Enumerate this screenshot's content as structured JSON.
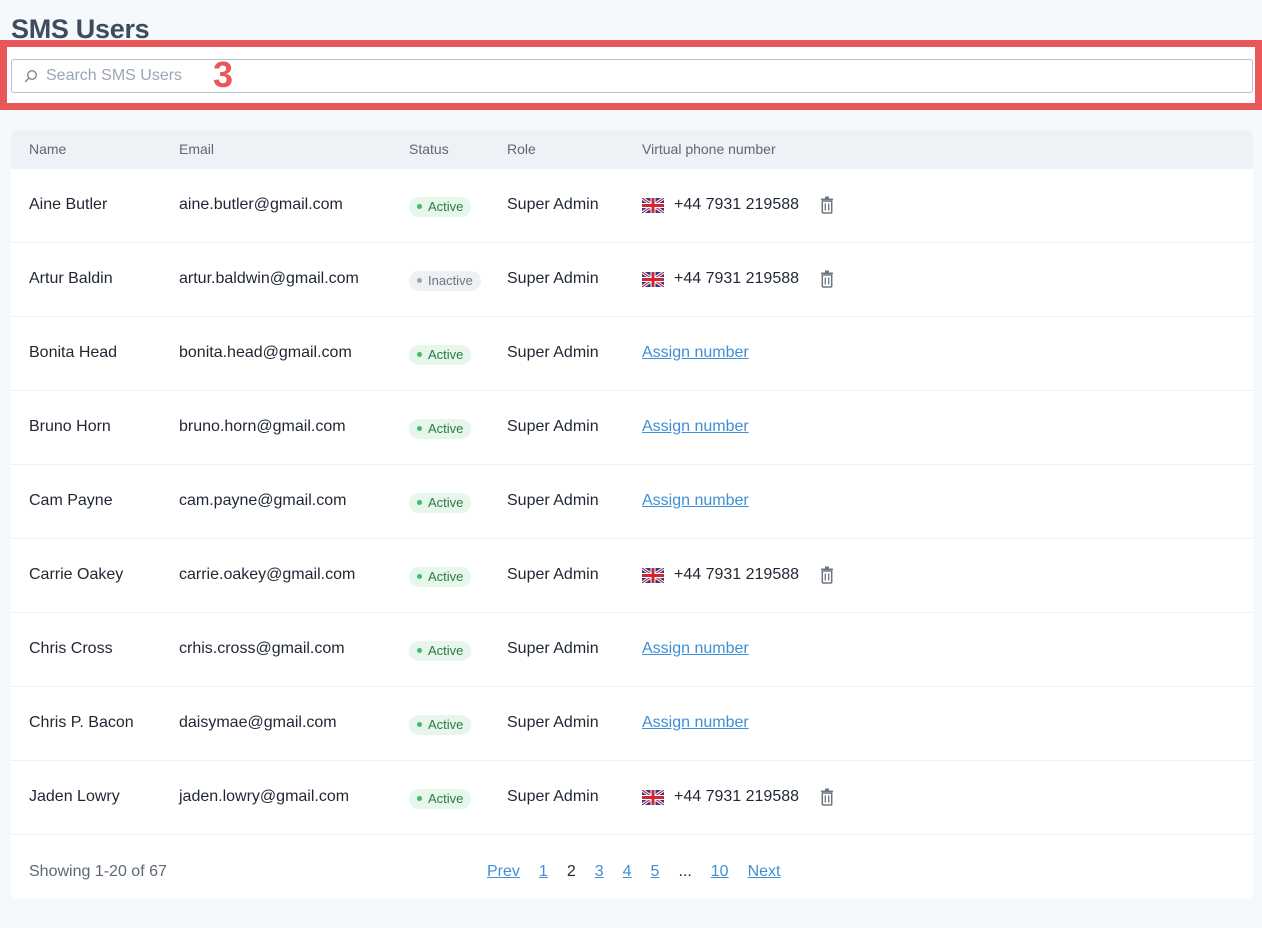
{
  "page": {
    "title": "SMS Users",
    "marker_label": "3"
  },
  "search": {
    "placeholder": "Search SMS Users",
    "value": ""
  },
  "table": {
    "columns": [
      "Name",
      "Email",
      "Status",
      "Role",
      "Virtual phone number"
    ],
    "rows": [
      {
        "name": "Aine Butler",
        "email": "aine.butler@gmail.com",
        "status": "Active",
        "role": "Super Admin",
        "phone": "+44 7931 219588"
      },
      {
        "name": "Artur Baldin",
        "email": "artur.baldwin@gmail.com",
        "status": "Inactive",
        "role": "Super Admin",
        "phone": "+44 7931 219588"
      },
      {
        "name": "Bonita Head",
        "email": "bonita.head@gmail.com",
        "status": "Active",
        "role": "Super Admin",
        "phone": null
      },
      {
        "name": "Bruno Horn",
        "email": "bruno.horn@gmail.com",
        "status": "Active",
        "role": "Super Admin",
        "phone": null
      },
      {
        "name": "Cam Payne",
        "email": "cam.payne@gmail.com",
        "status": "Active",
        "role": "Super Admin",
        "phone": null
      },
      {
        "name": "Carrie Oakey",
        "email": "carrie.oakey@gmail.com",
        "status": "Active",
        "role": "Super Admin",
        "phone": "+44 7931 219588"
      },
      {
        "name": "Chris Cross",
        "email": "crhis.cross@gmail.com",
        "status": "Active",
        "role": "Super Admin",
        "phone": null
      },
      {
        "name": "Chris P. Bacon",
        "email": "daisymae@gmail.com",
        "status": "Active",
        "role": "Super Admin",
        "phone": null
      },
      {
        "name": "Jaden Lowry",
        "email": "jaden.lowry@gmail.com",
        "status": "Active",
        "role": "Super Admin",
        "phone": "+44 7931 219588"
      }
    ],
    "assign_label": "Assign number",
    "flag_icon": "uk-flag-icon",
    "delete_icon": "trash-icon"
  },
  "pagination": {
    "showing": "Showing 1-20 of 67",
    "prev": "Prev",
    "next": "Next",
    "pages": [
      "1",
      "2",
      "3",
      "4",
      "5",
      "...",
      "10"
    ],
    "current": "2"
  },
  "colors": {
    "accent": "#3f8fd6",
    "highlight": "#e8585a",
    "active": "#3cc063"
  }
}
